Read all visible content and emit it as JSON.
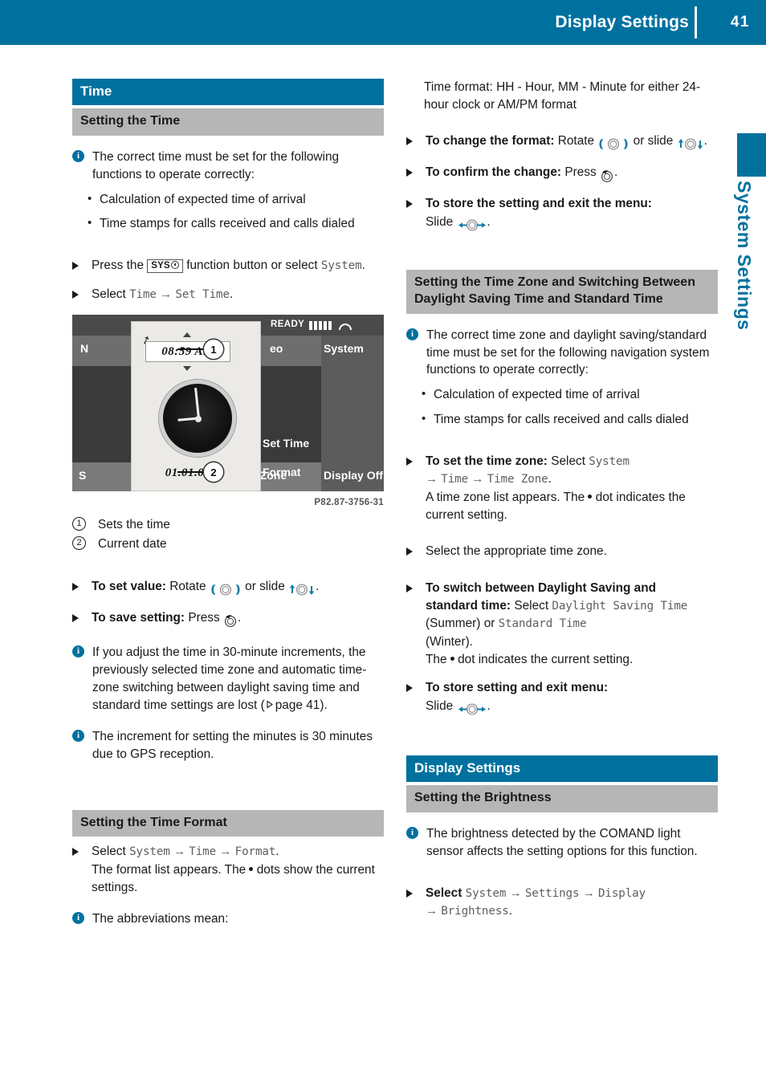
{
  "header": {
    "title": "Display Settings",
    "page_number": "41"
  },
  "side_tab": {
    "label": "System Settings"
  },
  "colors": {
    "brand_blue": "#00719f",
    "subhead_gray": "#b6b6b6",
    "mono_text": "#5e5e5e"
  },
  "left_column": {
    "section_heading": "Time",
    "sub_heading": "Setting the Time",
    "note_1": "The correct time must be set for the following functions to operate correctly:",
    "bullets": [
      "Calculation of expected time of arrival",
      "Time stamps for calls received and calls dialed"
    ],
    "step_press_prefix": "Press the",
    "step_press_mid": "function button or select",
    "step_press_mono": "System",
    "step_press_suffix": ".",
    "step_select_prefix": "Select",
    "step_select_mono_1": "Time",
    "step_select_arrow": "→",
    "step_select_mono_2": "Set Time",
    "step_select_suffix": ".",
    "figure": {
      "caption": "P82.87-3756-31",
      "screen": {
        "status_ready": "READY",
        "menu_nav": "N",
        "menu_video": "eo",
        "menu_system": "System",
        "bottom_left": "S",
        "bottom_timezone": "e Zone",
        "bottom_display_off": "Display Off",
        "list_set_time": "Set Time",
        "list_format": "Format",
        "popup_time": "08:59 AM",
        "popup_date": "01.01.07",
        "callout_1": "1",
        "callout_2": "2"
      }
    },
    "callouts": [
      {
        "num": "1",
        "text": "Sets the time"
      },
      {
        "num": "2",
        "text": "Current date"
      }
    ],
    "step_set_value_label": "To set value:",
    "step_set_value_rotate": "Rotate",
    "step_set_value_or": "or slide",
    "step_set_value_end": ".",
    "step_save_label": "To save setting:",
    "step_save_press": "Press",
    "step_save_end": ".",
    "note_2_a": "If you adjust the time in 30-minute increments, the previously selected time zone and automatic time-zone switching between daylight saving time and standard time settings are lost (",
    "note_2_pageref": "page 41",
    "note_2_b": ").",
    "note_3": "The increment for setting the minutes is 30 minutes due to GPS reception.",
    "format_sub_heading": "Setting the Time Format",
    "format_step_prefix": "Select",
    "format_mono_1": "System",
    "format_mono_2": "Time",
    "format_mono_3": "Format",
    "format_step_suffix": ".",
    "format_step_line2_a": "The format list appears. The",
    "format_step_line2_b": "dots show the current settings.",
    "note_4": "The abbreviations mean:"
  },
  "right_column": {
    "time_format_desc": "Time format: HH - Hour, MM - Minute for either 24-hour clock or AM/PM format",
    "step_change_label": "To change the format:",
    "step_change_rotate": "Rotate",
    "step_change_or": "or slide",
    "step_change_end": ".",
    "step_confirm_label": "To confirm the change:",
    "step_confirm_press": "Press",
    "step_confirm_end": ".",
    "step_store_label": "To store the setting and exit the menu:",
    "step_store_slide": "Slide",
    "step_store_end": ".",
    "tz_sub_heading": "Setting the Time Zone and Switching Between Daylight Saving Time and Standard Time",
    "tz_note": "The correct time zone and daylight saving/standard time must be set for the following navigation system functions to operate correctly:",
    "tz_bullets": [
      "Calculation of expected time of arrival",
      "Time stamps for calls received and calls dialed"
    ],
    "tz_set_label": "To set the time zone:",
    "tz_set_select": "Select",
    "tz_mono_1": "System",
    "tz_mono_2": "Time",
    "tz_mono_3": "Time Zone",
    "tz_set_end": ".",
    "tz_set_line_a": "A time zone list appears. The",
    "tz_set_line_b": "dot indicates the current setting.",
    "tz_select_appropriate": "Select the appropriate time zone.",
    "dst_label_a": "To switch between Daylight Saving and",
    "dst_label_b": "standard time:",
    "dst_select": "Select",
    "dst_mono_1": "Daylight Saving Time",
    "dst_summer": "(Summer)",
    "dst_or": "or",
    "dst_mono_2": "Standard Time",
    "dst_winter": "(Winter).",
    "dst_dot_a": "The",
    "dst_dot_b": "dot indicates the current setting.",
    "dst_store_label": "To store setting and exit menu:",
    "dst_store_slide": "Slide",
    "dst_store_end": ".",
    "display_heading": "Display Settings",
    "brightness_sub_heading": "Setting the Brightness",
    "brightness_note": "The brightness detected by the COMAND light sensor affects the setting options for this function.",
    "brightness_step_prefix": "Select",
    "brightness_mono_1": "System",
    "brightness_mono_2": "Settings",
    "brightness_mono_3": "Display",
    "brightness_mono_4": "Brightness",
    "brightness_step_suffix": "."
  },
  "icons": {
    "info_badge": "i",
    "sys_button": "SYS",
    "rotate_controller": "rotate-controller-icon",
    "slide_vertical_controller": "slide-vertical-controller-icon",
    "slide_horizontal_controller": "slide-horizontal-controller-icon",
    "press_controller": "press-controller-icon"
  }
}
